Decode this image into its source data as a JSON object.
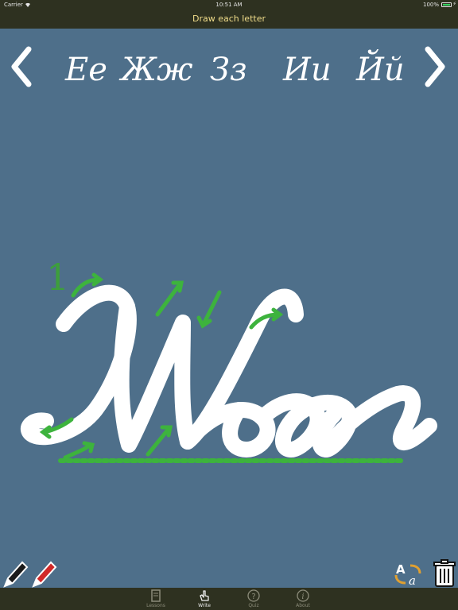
{
  "status": {
    "carrier": "Carrier",
    "time": "10:51 AM",
    "battery": "100%"
  },
  "nav": {
    "title": "Draw each letter"
  },
  "letters": [
    "Ее",
    "Жж",
    "Зз",
    "Ии",
    "Йй"
  ],
  "current_letter": "Жж",
  "stroke_number": "1",
  "tabs": [
    {
      "label": "Lessons",
      "icon": "book-icon",
      "active": false
    },
    {
      "label": "Write",
      "icon": "hand-icon",
      "active": true
    },
    {
      "label": "Quiz",
      "icon": "question-icon",
      "active": false
    },
    {
      "label": "About",
      "icon": "info-icon",
      "active": false
    }
  ],
  "colors": {
    "background": "#4e6f8a",
    "bar": "#2e3120",
    "title": "#f0dc8a",
    "guide": "#3db33d",
    "letter": "#ffffff"
  }
}
